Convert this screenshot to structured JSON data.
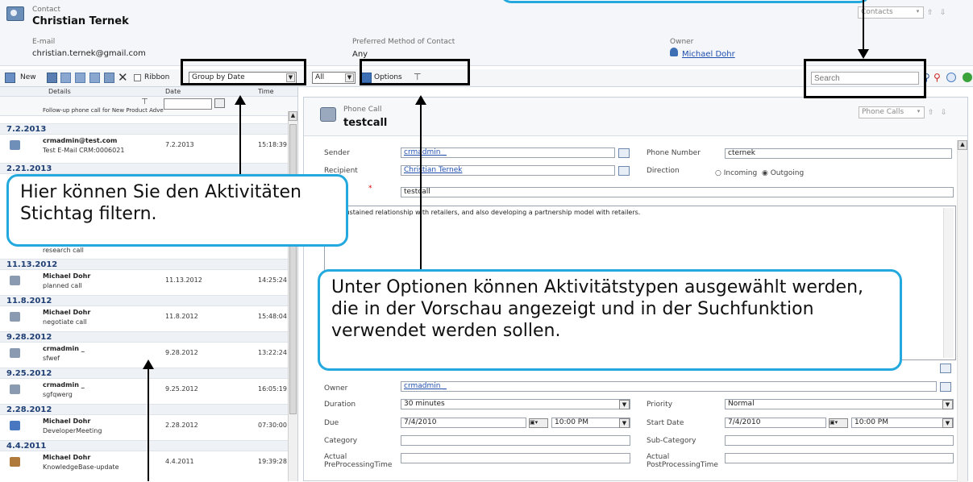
{
  "header": {
    "entity": "Contact",
    "name": "Christian Ternek",
    "email_label": "E-mail",
    "email": "christian.ternek@gmail.com",
    "pref_label": "Preferred Method of Contact",
    "pref_value": "Any",
    "owner_label": "Owner",
    "owner": "Michael Dohr",
    "contacts_select": "Contacts"
  },
  "toolbar": {
    "new_label": "New",
    "ribbon_label": "Ribbon",
    "group_by": "Group by Date",
    "all": "All",
    "options": "Options",
    "search_placeholder": "Search"
  },
  "list": {
    "col_details": "Details",
    "col_date": "Date",
    "col_time": "Time",
    "filter_text": "Follow-up phone call for New Product Adve",
    "groups": [
      {
        "date": "7.2.2013"
      },
      {
        "date": "2.21.2013"
      },
      {
        "date": "11.13.2012"
      },
      {
        "date": "11.8.2012"
      },
      {
        "date": "9.28.2012"
      },
      {
        "date": "9.25.2012"
      },
      {
        "date": "2.28.2012"
      },
      {
        "date": "4.4.2011"
      }
    ],
    "rows": [
      {
        "subject": "crmadmin@test.com",
        "detail": "Test E-Mail CRM:0006021",
        "date": "7.2.2013",
        "time": "15:18:39",
        "icon": "email-icon"
      },
      {
        "subject": "",
        "detail": "research call",
        "date": "",
        "time": "",
        "icon": ""
      },
      {
        "subject": "Michael Dohr",
        "detail": "planned call",
        "date": "11.13.2012",
        "time": "14:25:24",
        "icon": "phone-icon"
      },
      {
        "subject": "Michael Dohr",
        "detail": "negotiate call",
        "date": "11.8.2012",
        "time": "15:48:04",
        "icon": "phone-icon"
      },
      {
        "subject": "crmadmin _",
        "detail": "sfwef",
        "date": "9.28.2012",
        "time": "13:22:24",
        "icon": "phone-icon"
      },
      {
        "subject": "crmadmin _",
        "detail": "sgfqwerg",
        "date": "9.25.2012",
        "time": "16:05:19",
        "icon": "phone-icon"
      },
      {
        "subject": "Michael Dohr",
        "detail": "DeveloperMeeting",
        "date": "2.28.2012",
        "time": "07:30:00",
        "icon": "appointment-icon"
      },
      {
        "subject": "Michael Dohr",
        "detail": "KnowledgeBase-update",
        "date": "4.4.2011",
        "time": "19:39:28",
        "icon": "task-icon"
      }
    ]
  },
  "form": {
    "type": "Phone Call",
    "title": "testcall",
    "phone_calls_select": "Phone Calls",
    "sender_label": "Sender",
    "sender": "crmadmin _",
    "phone_label": "Phone Number",
    "phone": "cternek",
    "recipient_label": "Recipient",
    "recipient": "Christian Ternek",
    "direction_label": "Direction",
    "incoming": "Incoming",
    "outgoing": "Outgoing",
    "subject_required": "*",
    "subject": "testcall",
    "description": "ld a sustained relationship with retailers, and also developing a partnership model with retailers.",
    "owner_label": "Owner",
    "owner": "crmadmin _",
    "duration_label": "Duration",
    "duration": "30 minutes",
    "priority_label": "Priority",
    "priority": "Normal",
    "due_label": "Due",
    "due_date": "7/4/2010",
    "due_time": "10:00 PM",
    "start_label": "Start Date",
    "start_date": "7/4/2010",
    "start_time": "10:00 PM",
    "category_label": "Category",
    "subcategory_label": "Sub-Category",
    "actual_pre_label_1": "Actual",
    "actual_pre_label_2": "PreProcessingTime",
    "actual_post_label_1": "Actual",
    "actual_post_label_2": "PostProcessingTime"
  },
  "callouts": {
    "filter": "Hier können Sie den Aktivitäten Stichtag filtern.",
    "options": "Unter Optionen können Aktivitätstypen ausgewählt werden, die in der Vorschau angezeigt und in der Suchfunktion verwendet werden sollen."
  },
  "colors": {
    "callout_border": "#24a9de",
    "link": "#1f4fae",
    "group_text": "#1f3f74"
  }
}
